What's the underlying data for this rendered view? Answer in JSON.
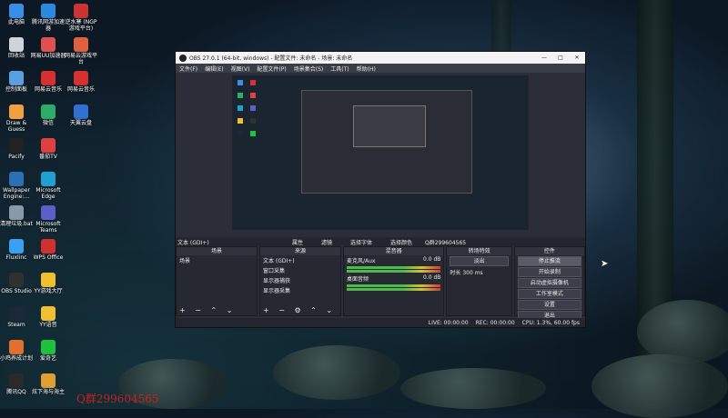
{
  "desktop": {
    "icons_col1": [
      {
        "label": "此电脑",
        "color": "#3a8ee6"
      },
      {
        "label": "回收站",
        "color": "#cfd4da"
      },
      {
        "label": "控制面板",
        "color": "#5aa0e0"
      },
      {
        "label": "Draw & Guess",
        "color": "#f0a040"
      },
      {
        "label": "Pacify",
        "color": "#222222"
      },
      {
        "label": "Wallpaper Engine:...",
        "color": "#2c6fb5"
      },
      {
        "label": "清理垃圾.bat",
        "color": "#8899aa"
      },
      {
        "label": "Fluxlinc",
        "color": "#3aa0f0"
      },
      {
        "label": "OBS Studio",
        "color": "#303030"
      },
      {
        "label": "Steam",
        "color": "#1b2838"
      },
      {
        "label": "小鸡养成计划",
        "color": "#e07030"
      },
      {
        "label": "腾讯QQ",
        "color": "#2a2a2a"
      }
    ],
    "icons_col2": [
      {
        "label": "腾讯网游加速器",
        "color": "#2a8ae0"
      },
      {
        "label": "网易UU加速器",
        "color": "#e05050"
      },
      {
        "label": "网易云音乐",
        "color": "#d63030"
      },
      {
        "label": "微信",
        "color": "#2aae67"
      },
      {
        "label": "番茄TV",
        "color": "#e04040"
      },
      {
        "label": "Microsoft Edge",
        "color": "#1fa0d0"
      },
      {
        "label": "Microsoft Teams",
        "color": "#5b5fc7"
      },
      {
        "label": "WPS Office",
        "color": "#d03030"
      },
      {
        "label": "YY游戏大厅",
        "color": "#f0c030"
      },
      {
        "label": "YY语音",
        "color": "#f0c030"
      },
      {
        "label": "爱奇艺",
        "color": "#20c040"
      },
      {
        "label": "炫下海与海主",
        "color": "#e0a030"
      }
    ],
    "icons_col3": [
      {
        "label": "逆水寒 (NGP游戏平台)",
        "color": "#cc3333"
      },
      {
        "label": "网易云游戏平台",
        "color": "#e06040"
      },
      {
        "label": "网易云音乐",
        "color": "#d63030"
      },
      {
        "label": "天翼云盘",
        "color": "#3070d0"
      }
    ],
    "watermark": "Q群299604565"
  },
  "obs": {
    "title": "OBS 27.0.1 (64-bit, windows) - 配置文件: 未命名 - 场景: 未命名",
    "menu": [
      "文件(F)",
      "编辑(E)",
      "视图(V)",
      "配置文件(P)",
      "场景集合(S)",
      "工具(T)",
      "帮助(H)"
    ],
    "scene_bar": {
      "source_label": "文本 (GDI+)",
      "props": "属性",
      "filters": "滤镜",
      "selected_label": "选择字体",
      "extra_label": "选择颜色",
      "text_value": "Q群299604565"
    },
    "docks": {
      "scenes": {
        "title": "场景",
        "items": [
          "场景"
        ]
      },
      "sources": {
        "title": "来源",
        "items": [
          "文本 (GDI+)",
          "窗口采集",
          "显示器捕获",
          "显示器采集"
        ]
      },
      "mixer": {
        "title": "混音器",
        "channels": [
          {
            "name": "桌面音频",
            "db": "0.0 dB"
          },
          {
            "name": "麦克风/Aux",
            "db": "0.0 dB"
          }
        ]
      },
      "transitions": {
        "title": "转场特效",
        "type": "淡出",
        "duration_label": "时长",
        "duration": "300 ms"
      },
      "controls": {
        "title": "控件",
        "buttons": [
          "停止推流",
          "开始录制",
          "启动虚拟摄像机",
          "工作室模式",
          "设置",
          "退出"
        ]
      }
    },
    "status": {
      "live": "LIVE: 00:00:00",
      "rec": "REC: 00:00:00",
      "cpu": "CPU: 1.3%, 60.00 fps"
    }
  }
}
